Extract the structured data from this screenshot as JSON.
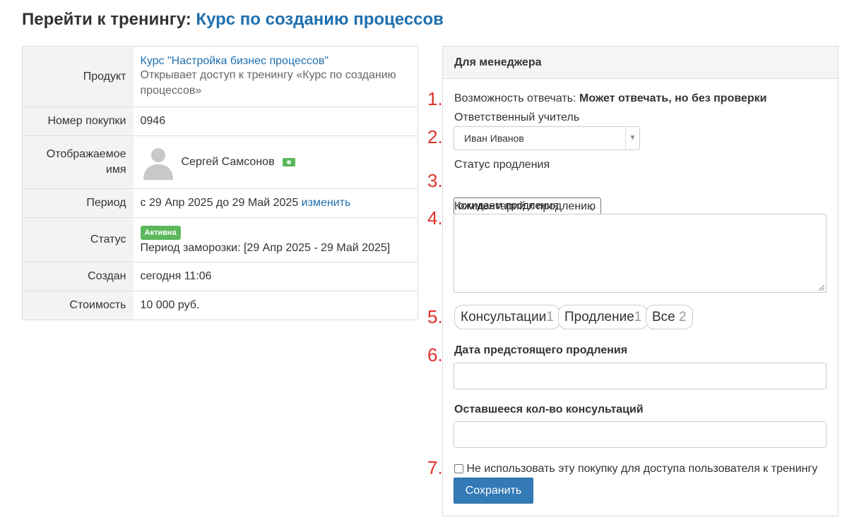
{
  "header": {
    "title_prefix": "Перейти к тренингу:",
    "course_link": "Курс по созданию процессов"
  },
  "info": {
    "product": {
      "label": "Продукт",
      "link": "Курс \"Настройка бизнес процессов\"",
      "description": "Открывает доступ к тренингу «Курс по созданию процессов»"
    },
    "purchase_number": {
      "label": "Номер покупки",
      "value": "0946"
    },
    "display_name": {
      "label": "Отображаемое имя",
      "value": "Сергей Самсонов",
      "avatar_icon": "user-silhouette-icon",
      "money_icon": "money-icon"
    },
    "period": {
      "label": "Период",
      "value": "с 29 Апр 2025 до 29 Май 2025",
      "change_link": "изменить"
    },
    "status": {
      "label": "Статус",
      "badge": "Активна",
      "badge_color": "#5cb85c",
      "freeze": "Период заморозки: [29 Апр 2025 - 29 Май 2025]"
    },
    "created": {
      "label": "Создан",
      "value": "сегодня 11:06"
    },
    "cost": {
      "label": "Стоимость",
      "value": "10 000 руб."
    }
  },
  "manager": {
    "title": "Для менеджера",
    "markers": [
      "1.",
      "2.",
      "3.",
      "4.",
      "5.",
      "6.",
      "7."
    ],
    "reply_label": "Возможность отвечать:",
    "reply_value": "Может отвечать, но без проверки",
    "teacher_label": "Ответственный учитель",
    "teacher_value": "Иван Иванов",
    "renewal_status_label": "Статус продления",
    "renewal_status_value": "ожидаем продления",
    "comment_label": "Комментарий к продлению",
    "comment_value": "",
    "tabs": [
      {
        "label": "Консультации",
        "count": "1"
      },
      {
        "label": "Продление",
        "count": "1"
      },
      {
        "label": "Все",
        "count": "2"
      }
    ],
    "next_renewal_label": "Дата предстоящего продления",
    "next_renewal_value": "",
    "remaining_label": "Оставшееся кол-во консультаций",
    "remaining_value": "",
    "no_access_label": "Не использовать эту покупку для доступа пользователя к тренингу",
    "no_access_checked": false,
    "save_label": "Сохранить",
    "accent_color": "#337ab7",
    "marker_color": "#e0312a"
  }
}
